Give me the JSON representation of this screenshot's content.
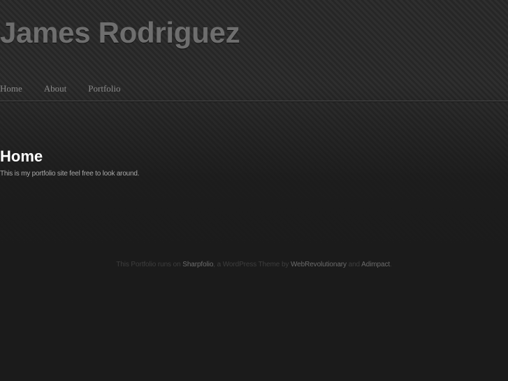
{
  "header": {
    "site_title": "James Rodriguez",
    "nav": [
      {
        "label": "Home"
      },
      {
        "label": "About"
      },
      {
        "label": "Portfolio"
      }
    ]
  },
  "main": {
    "heading": "Home",
    "body": "This is my portfolio site feel free to look around."
  },
  "footer": {
    "prefix": "This Portfolio runs on",
    "theme_link": "Sharpfolio",
    "middle": ", a WordPress Theme by",
    "author_link_1": "WebRevolutionary",
    "and": "and",
    "author_link_2": "Adimpact",
    "suffix": "."
  },
  "colors": {
    "background": "#222222",
    "title": "#6e6e6e",
    "nav": "#8a8a8a",
    "heading": "#ffffff",
    "body_text": "#a8a8a8",
    "footer_text": "#3e3e3e",
    "footer_link": "#6c6c6c"
  }
}
